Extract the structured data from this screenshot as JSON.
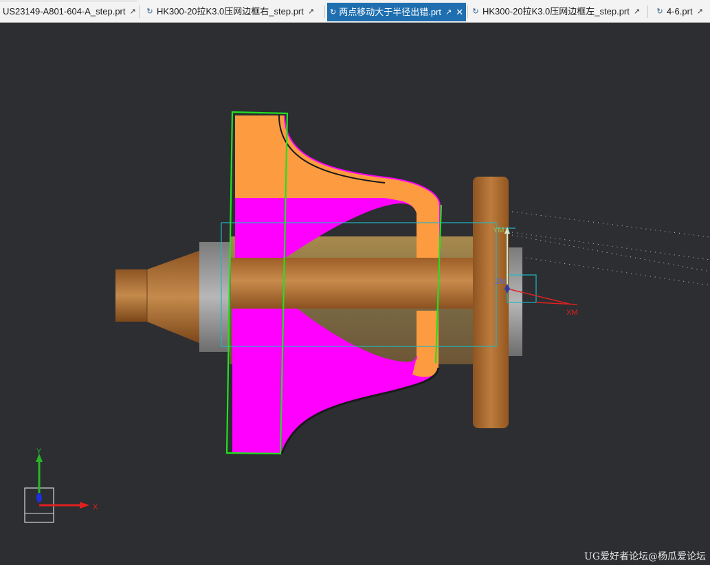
{
  "tabs": [
    {
      "label": "US23149-A801-604-A_step.prt",
      "active": false,
      "has_ref_icon": false
    },
    {
      "label": "HK300-20拉K3.0压网边框右_step.prt",
      "active": false,
      "has_ref_icon": true
    },
    {
      "label": "两点移动大于半径出错.prt",
      "active": true,
      "has_ref_icon": true
    },
    {
      "label": "HK300-20拉K3.0压网边框左_step.prt",
      "active": false,
      "has_ref_icon": true
    },
    {
      "label": "4-6.prt",
      "active": false,
      "has_ref_icon": true
    }
  ],
  "tab_icons": {
    "reference": "file-ref-icon",
    "activate": "activate-icon",
    "close": "close-icon"
  },
  "model_csys": {
    "x_label": "XM",
    "y_label": "YM",
    "z_label": "ZM"
  },
  "view_triad": {
    "x_label": "X",
    "y_label": "Y"
  },
  "watermark": "UG爱好者论坛@杨瓜爱论坛",
  "colors": {
    "background": "#2c2e31",
    "tab_active": "#1f6fb0",
    "part_bronze": "#b97532",
    "part_orange": "#fd9b40",
    "part_magenta": "#ff00ff",
    "part_gray": "#8c8c8c",
    "bounding_box_green": "#22e020",
    "bounding_box_cyan": "#1fb8c2",
    "axis_red": "#e02020",
    "axis_green": "#28b628",
    "axis_blue": "#1e2fd8"
  }
}
